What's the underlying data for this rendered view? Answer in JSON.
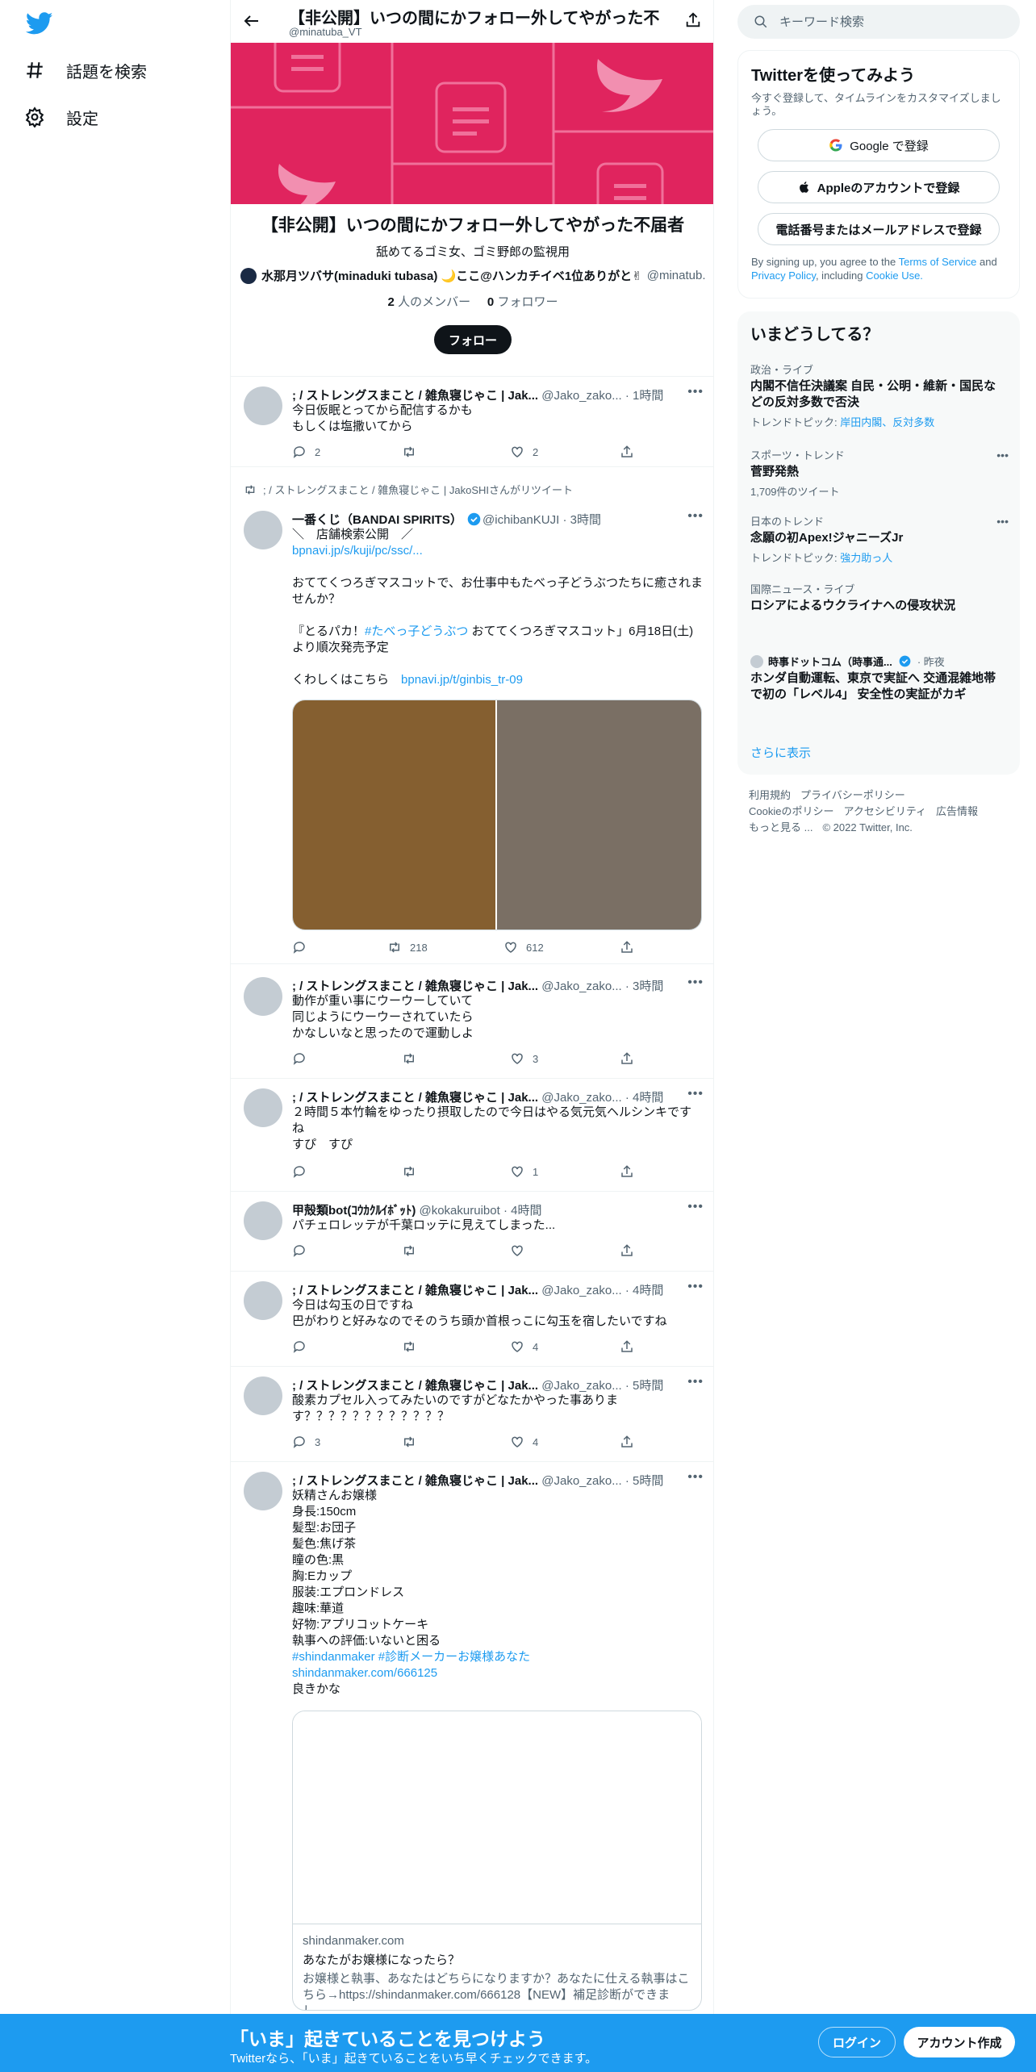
{
  "nav": {
    "explore": "話題を検索",
    "settings": "設定"
  },
  "header": {
    "title": "【非公開】いつの間にかフォロー外してやがった不",
    "handle": "@minatuba_VT"
  },
  "list": {
    "name": "【非公開】いつの間にかフォロー外してやがった不届者",
    "description": "舐めてるゴミ女、ゴミ野郎の監視用",
    "owner_name": "水那月ツバサ(minaduki tubasa) 🌙ここ@ハンカチイベ1位ありがと✌",
    "owner_handle": "@minatub...",
    "members_count": "2",
    "members_label": "人のメンバー",
    "followers_count": "0",
    "followers_label": "フォロワー",
    "follow_label": "フォロー"
  },
  "tweets": [
    {
      "name": "; / ストレングスまこと / 雑魚寝じゃこ | Jak...",
      "handle": "@Jako_zako...",
      "time": "· 1時間",
      "text": "今日仮眠とってから配信するかも\nもしくは塩撒いてから",
      "reply": "2",
      "retweet": "",
      "like": "2"
    },
    {
      "retweeted_by": "; / ストレングスまこと / 雑魚寝じゃこ | JakoSHIさんがリツイート",
      "name": "一番くじ（BANDAI SPIRITS）",
      "handle": "@ichibanKUJI",
      "time": "· 3時間",
      "text1": "＼　店舗検索公開　／",
      "link1": "bpnavi.jp/s/kuji/pc/ssc/...",
      "text2": "おててくつろぎマスコットで、お仕事中もたべっ子どうぶつたちに癒されませんか？",
      "text3a": "『とるパカ！",
      "hashtag": "#たべっ子どうぶつ",
      "text3b": " おててくつろぎマスコット」6月18日(土)より順次発売予定",
      "text4": "くわしくはこちら　",
      "link2": "bpnavi.jp/t/ginbis_tr-09",
      "reply": "",
      "retweet": "218",
      "like": "612"
    },
    {
      "name": "; / ストレングスまこと / 雑魚寝じゃこ | Jak...",
      "handle": "@Jako_zako...",
      "time": "· 3時間",
      "text": "動作が重い事にウーウーしていて\n同じようにウーウーされていたら\nかなしいなと思ったので運動しよ",
      "reply": "",
      "retweet": "",
      "like": "3"
    },
    {
      "name": "; / ストレングスまこと / 雑魚寝じゃこ | Jak...",
      "handle": "@Jako_zako...",
      "time": "· 4時間",
      "text": "２時間５本竹輪をゆったり摂取したので今日はやる気元気ヘルシンキです\nね\nすぴ　すぴ",
      "reply": "",
      "retweet": "",
      "like": "1"
    },
    {
      "name": "甲殻類bot(ｺｳｶｸﾙｲﾎﾞｯﾄ)",
      "handle": "@kokakuruibot",
      "time": "· 4時間",
      "text": "パチェロレッテが千葉ロッテに見えてしまった...",
      "reply": "",
      "retweet": "",
      "like": ""
    },
    {
      "name": "; / ストレングスまこと / 雑魚寝じゃこ | Jak...",
      "handle": "@Jako_zako...",
      "time": "· 4時間",
      "text": "今日は勾玉の日ですね\n巴がわりと好みなのでそのうち頭か首根っこに勾玉を宿したいですね",
      "reply": "",
      "retweet": "",
      "like": "4"
    },
    {
      "name": "; / ストレングスまこと / 雑魚寝じゃこ | Jak...",
      "handle": "@Jako_zako...",
      "time": "· 5時間",
      "text": "酸素カプセル入ってみたいのですがどなたかやった事ありま\nす？？？？？？？？？？？？",
      "reply": "3",
      "retweet": "",
      "like": "4"
    },
    {
      "name": "; / ストレングスまこと / 雑魚寝じゃこ | Jak...",
      "handle": "@Jako_zako...",
      "time": "· 5時間",
      "text": "妖精さんお嬢様\n身長:150cm\n髪型:お団子\n髪色:焦げ茶\n瞳の色:黒\n胸:Eカップ\n服装:エプロンドレス\n趣味:華道\n好物:アプリコットケーキ\n執事への評価:いないと困る",
      "hashtags": "#shindanmaker #診断メーカーお嬢様あなた",
      "link": "shindanmaker.com/666125",
      "tail": "良きかな",
      "card_domain": "shindanmaker.com",
      "card_title": "あなたがお嬢様になったら？",
      "card_desc": "お嬢様と執事、あなたはどちらになりますか？あなたに仕える執事はこちら→https://shindanmaker.com/666128【NEW】補足診断ができまし..."
    }
  ],
  "right": {
    "search_placeholder": "キーワード検索",
    "signup_title": "Twitterを使ってみよう",
    "signup_desc": "今すぐ登録して、タイムラインをカスタマイズしましょう。",
    "google_btn": "Google で登録",
    "apple_btn": "Appleのアカウントで登録",
    "phone_btn": "電話番号またはメールアドレスで登録",
    "terms_prefix": "By signing up, you agree to the ",
    "terms_tos": "Terms of Service",
    "terms_and": " and ",
    "terms_privacy": "Privacy Policy",
    "terms_including": ", including ",
    "terms_cookie": "Cookie Use.",
    "trends_title": "いまどうしてる？",
    "trends": [
      {
        "category": "政治・ライブ",
        "title": "内閣不信任決議案 自民・公明・維新・国民などの反対多数で否決",
        "sub_prefix": "トレンドトピック: ",
        "sub_link": "岸田内閣、反対多数"
      },
      {
        "category": "スポーツ・トレンド",
        "title": "菅野発熱",
        "sub": "1,709件のツイート"
      },
      {
        "category": "日本のトレンド",
        "title": "念願の初Apex!ジャニーズJr",
        "sub_prefix": "トレンドトピック: ",
        "sub_link": "強力助っ人"
      },
      {
        "category": "国際ニュース・ライブ",
        "title": "ロシアによるウクライナへの侵攻状況"
      },
      {
        "source": "時事ドットコム（時事通...",
        "time": "· 昨夜",
        "title": "ホンダ自動運転、東京で実証へ 交通混雑地帯で初の「レベル4」 安全性の実証がカギ"
      }
    ],
    "show_more": "さらに表示",
    "footer": [
      "利用規約",
      "プライバシーポリシー",
      "Cookieのポリシー",
      "アクセシビリティ",
      "広告情報",
      "もっと見る ...",
      "© 2022 Twitter, Inc."
    ]
  },
  "bottombar": {
    "title": "「いま」起きていることを見つけよう",
    "subtitle": "Twitterなら、「いま」起きていることをいち早くチェックできます。",
    "login": "ログイン",
    "signup": "アカウント作成"
  },
  "colors": {
    "accent": "#1d9bf0",
    "banner": "#e0245e",
    "text": "#0f1419",
    "muted": "#536471"
  }
}
